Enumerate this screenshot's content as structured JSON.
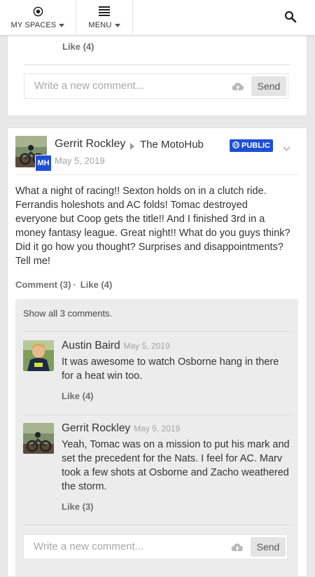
{
  "nav": {
    "my_spaces": "MY SPACES",
    "menu": "MENU"
  },
  "card1": {
    "like_label": "Like (4)",
    "comment_placeholder": "Write a new comment...",
    "send_label": "Send"
  },
  "post": {
    "author": "Gerrit Rockley",
    "space": "The MotoHub",
    "visibility": "PUBLIC",
    "date": "May 5, 2019",
    "body": "What a night of racing!! Sexton holds on in a clutch ride. Ferrandis holeshots and AC folds! Tomac destroyed everyone but Coop gets the title!! And I finished 3rd in a money fantasy league. Great night!! What do you guys think? Did it go how you thought? Surprises and disappointments? Tell me!",
    "comment_action": "Comment (3)",
    "separator": "·",
    "like_action": "Like (4)",
    "badge_letters": "MH",
    "colors": {
      "badge": "#1d4fd6"
    }
  },
  "comments": {
    "show_all": "Show all 3 comments.",
    "items": [
      {
        "author": "Austin Baird",
        "date": "May 5, 2019",
        "text": "It was awesome to watch Osborne hang in there for a heat win too.",
        "like_label": "Like (4)"
      },
      {
        "author": "Gerrit Rockley",
        "date": "May 5, 2019",
        "text": "Yeah, Tomac was on a mission to put his mark and set the precedent for the Nats. I feel for AC. Marv took a few shots at Osborne and Zacho weathered the storm.",
        "like_label": "Like (3)"
      }
    ],
    "comment_placeholder": "Write a new comment...",
    "send_label": "Send"
  }
}
